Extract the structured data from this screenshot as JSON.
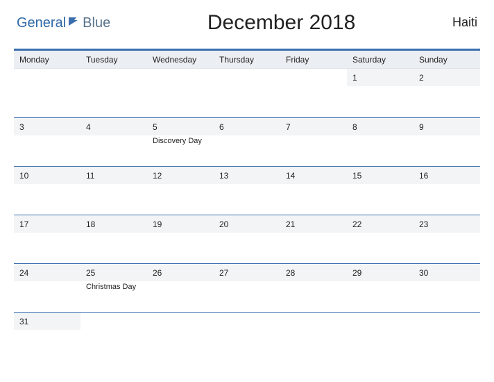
{
  "logo": {
    "part1": "General",
    "part2": "Blue"
  },
  "title": "December 2018",
  "country": "Haiti",
  "weekdays": [
    "Monday",
    "Tuesday",
    "Wednesday",
    "Thursday",
    "Friday",
    "Saturday",
    "Sunday"
  ],
  "colors": {
    "accent": "#3b6fae",
    "header_bg": "#ebeef2",
    "day_bg": "#f2f4f6"
  },
  "weeks": [
    [
      {
        "day": null
      },
      {
        "day": null
      },
      {
        "day": null
      },
      {
        "day": null
      },
      {
        "day": null
      },
      {
        "day": 1
      },
      {
        "day": 2
      }
    ],
    [
      {
        "day": 3
      },
      {
        "day": 4
      },
      {
        "day": 5,
        "event": "Discovery Day"
      },
      {
        "day": 6
      },
      {
        "day": 7
      },
      {
        "day": 8
      },
      {
        "day": 9
      }
    ],
    [
      {
        "day": 10
      },
      {
        "day": 11
      },
      {
        "day": 12
      },
      {
        "day": 13
      },
      {
        "day": 14
      },
      {
        "day": 15
      },
      {
        "day": 16
      }
    ],
    [
      {
        "day": 17
      },
      {
        "day": 18
      },
      {
        "day": 19
      },
      {
        "day": 20
      },
      {
        "day": 21
      },
      {
        "day": 22
      },
      {
        "day": 23
      }
    ],
    [
      {
        "day": 24
      },
      {
        "day": 25,
        "event": "Christmas Day"
      },
      {
        "day": 26
      },
      {
        "day": 27
      },
      {
        "day": 28
      },
      {
        "day": 29
      },
      {
        "day": 30
      }
    ],
    [
      {
        "day": 31
      },
      {
        "day": null
      },
      {
        "day": null
      },
      {
        "day": null
      },
      {
        "day": null
      },
      {
        "day": null
      },
      {
        "day": null
      }
    ]
  ]
}
